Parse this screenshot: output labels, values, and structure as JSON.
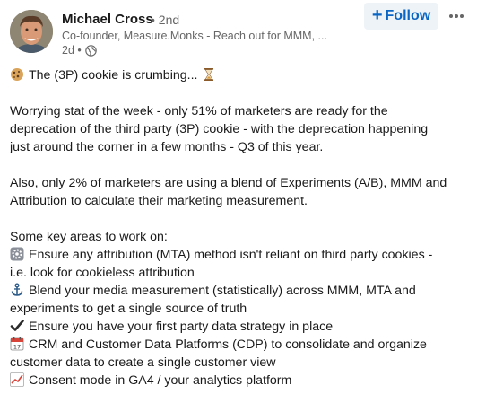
{
  "author": {
    "name": "Michael Cross",
    "degree": "• 2nd",
    "headline": "Co-founder, Measure.Monks - Reach out for MMM, ...",
    "time": "2d •"
  },
  "actions": {
    "follow_label": "Follow"
  },
  "post": {
    "title_line": "The (3P) cookie is crumbing...",
    "para1": [
      "Worrying stat of the week - only 51% of marketers are ready for the",
      "deprecation of the third party (3P) cookie - with the deprecation happening",
      "just around the corner in a few months - Q3 of this year."
    ],
    "para2": [
      "Also, only 2% of marketers are using a blend of Experiments (A/B), MMM and",
      "Attribution to calculate their marketing measurement."
    ],
    "areas_heading": "Some key areas to work on:",
    "areas": [
      {
        "icon": "gear-icon",
        "lines": [
          "Ensure any attribution (MTA) method isn't reliant on third party cookies -",
          "i.e. look for cookieless attribution"
        ]
      },
      {
        "icon": "anchor-icon",
        "lines": [
          "Blend your media measurement (statistically) across MMM, MTA and",
          "experiments to get a single source of truth"
        ]
      },
      {
        "icon": "check-icon",
        "lines": [
          "Ensure you have your first party data strategy in place"
        ]
      },
      {
        "icon": "calendar-icon",
        "lines": [
          "CRM and Customer Data Platforms (CDP) to consolidate and organize",
          "customer data to create a single customer view"
        ]
      },
      {
        "icon": "chart-icon",
        "lines": [
          "Consent mode in GA4 / your analytics platform"
        ]
      }
    ]
  },
  "colors": {
    "accent": "#0a66c2",
    "follow_bg": "#eef3f8",
    "muted": "#666666",
    "text": "#191919"
  }
}
